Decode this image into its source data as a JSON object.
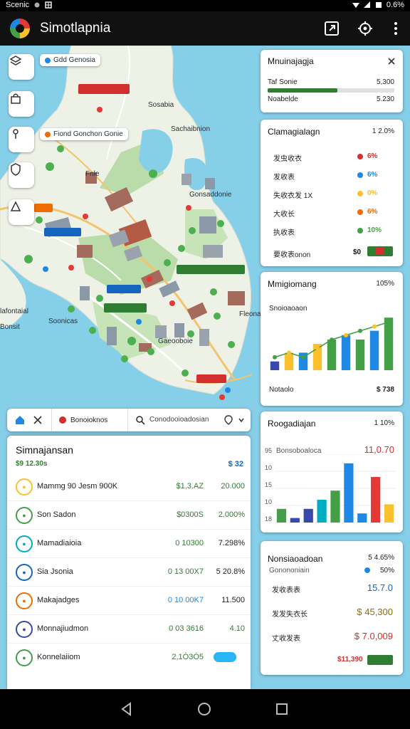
{
  "status_bar": {
    "left_text": "Scenic",
    "right_text": "0.6%"
  },
  "app": {
    "title": "Simotlapnia"
  },
  "map": {
    "chips": {
      "top_chip": "Gdd Genosia",
      "mid_chip": "Fiond Gonchon Gonie"
    },
    "labels": {
      "north": "Sosabia",
      "east_upper": "Sachaibnion",
      "east_mid": "Gonsaddonie",
      "bridge": "Fnle",
      "west_a": "lafontaial",
      "west_b": "Bonsit",
      "south_west": "Soonicas",
      "south": "Gaeooboie",
      "east_low": "Fleona"
    }
  },
  "cards": {
    "mini": {
      "title": "Mnuinajagja",
      "row1_label": "Taf Sonie",
      "row1_value": "5,300",
      "row2_label": "Noabelde",
      "row2_value": "5.230",
      "progress1": 0.55,
      "progress2": 0.88
    },
    "list": {
      "title": "Clamagialagn",
      "pct": "1 2.0%",
      "rows": [
        {
          "label": "发虫收衣",
          "value": "6%",
          "color": "#d32f2f"
        },
        {
          "label": "发收表",
          "value": "6%",
          "color": "#1e88e5"
        },
        {
          "label": "失收衣发 1X",
          "value": "0%",
          "color": "#fbc02d"
        },
        {
          "label": "大收长",
          "value": "6%",
          "color": "#ef6c00"
        },
        {
          "label": "执收表",
          "value": "10%",
          "color": "#43a047"
        }
      ],
      "footer_label": "要收表onon",
      "footer_value": "$0"
    },
    "line_bar": {
      "title": "Mmigiomang",
      "pct": "105%",
      "subtitle": "Snoioaoaon",
      "footer_label": "Notaolo",
      "footer_value": "$ 738",
      "chart_data": {
        "type": "bar",
        "values": [
          2,
          4,
          4,
          6,
          7,
          8,
          7,
          9,
          12
        ],
        "line_values": [
          2,
          3,
          2,
          4,
          6,
          7,
          8,
          9,
          10
        ],
        "colors": [
          "#3949ab",
          "#fbc02d",
          "#1e88e5",
          "#fbc02d",
          "#43a047",
          "#1e88e5",
          "#43a047",
          "#1e88e5",
          "#43a047"
        ],
        "ylim": [
          0,
          13
        ]
      }
    },
    "bar": {
      "title": "Roogadiajan",
      "pct": "1 10%",
      "subtitle": "Bonsoboaloca",
      "ylabel_top": "95",
      "big_value": "11,0.70",
      "chart_data": {
        "type": "bar",
        "yticks": [
          "95",
          "10",
          "15",
          "10",
          "18"
        ],
        "values": [
          3,
          1,
          3,
          5,
          7,
          13,
          2,
          10,
          4
        ],
        "colors": [
          "#43a047",
          "#3949ab",
          "#3949ab",
          "#00acc1",
          "#43a047",
          "#1e88e5",
          "#1e88e5",
          "#e53935",
          "#fbc02d"
        ],
        "ylim": [
          0,
          15
        ]
      }
    },
    "summary": {
      "title": "Nonsiaoadoan",
      "pct": "5 4.65%",
      "row0_label": "Gonononiain",
      "row0_value": "50%",
      "rows": [
        {
          "label": "发收表表",
          "value": "15.7.0",
          "color": "#1565c0"
        },
        {
          "label": "发发失衣长",
          "value": "$ 45,300",
          "color": "#8d6e00"
        },
        {
          "label": "丈收发表",
          "value": "$ 7.0,009",
          "color": "#d32f2f"
        }
      ],
      "footer_value": "$11,390"
    }
  },
  "tabs": {
    "home_icon": "home-icon",
    "tab_a": "Bonoioknos",
    "search_label": "Conodooioadosian"
  },
  "sheet": {
    "title": "Simnajansan",
    "subtitle": "$9 12.30s",
    "subtitle_value": "$ 32",
    "rows": [
      {
        "name": "Mammg 90 Jesm 900K",
        "v1": "$1,3.AZ",
        "v2": "20.000",
        "color": "#fbc02d",
        "v1_color": "#2e7d32",
        "v2_color": "#2e7d32"
      },
      {
        "name": "Son Sadon",
        "v1": "$0300S",
        "v2": "2.000%",
        "color": "#43a047",
        "v1_color": "#2e7d32",
        "v2_color": "#2e7d32"
      },
      {
        "name": "Mamadiaioia",
        "v1": "0 10300",
        "v2": "7.298%",
        "color": "#00acc1",
        "v1_color": "#2e7d32",
        "v2_color": "#222222"
      },
      {
        "name": "Sia Jsonia",
        "v1": "0 13 00X7",
        "v2": "5 20.8%",
        "color": "#1565c0",
        "v1_color": "#2e7d32",
        "v2_color": "#222222"
      },
      {
        "name": "Makajadges",
        "v1": "0 10 00K7",
        "v2": "11.500",
        "color": "#ef6c00",
        "v1_color": "#1e88e5",
        "v2_color": "#222222"
      },
      {
        "name": "Monnajiudmon",
        "v1": "0 03 3616",
        "v2": "4.10",
        "color": "#3949ab",
        "v1_color": "#2e7d32",
        "v2_color": "#2e7d32"
      },
      {
        "name": "Konnelaiiom",
        "v1": "2,1Ó3Ó5",
        "v2": "",
        "color": "#43a047",
        "v1_color": "#2e7d32",
        "v2_color": "#2e7d32"
      }
    ]
  }
}
